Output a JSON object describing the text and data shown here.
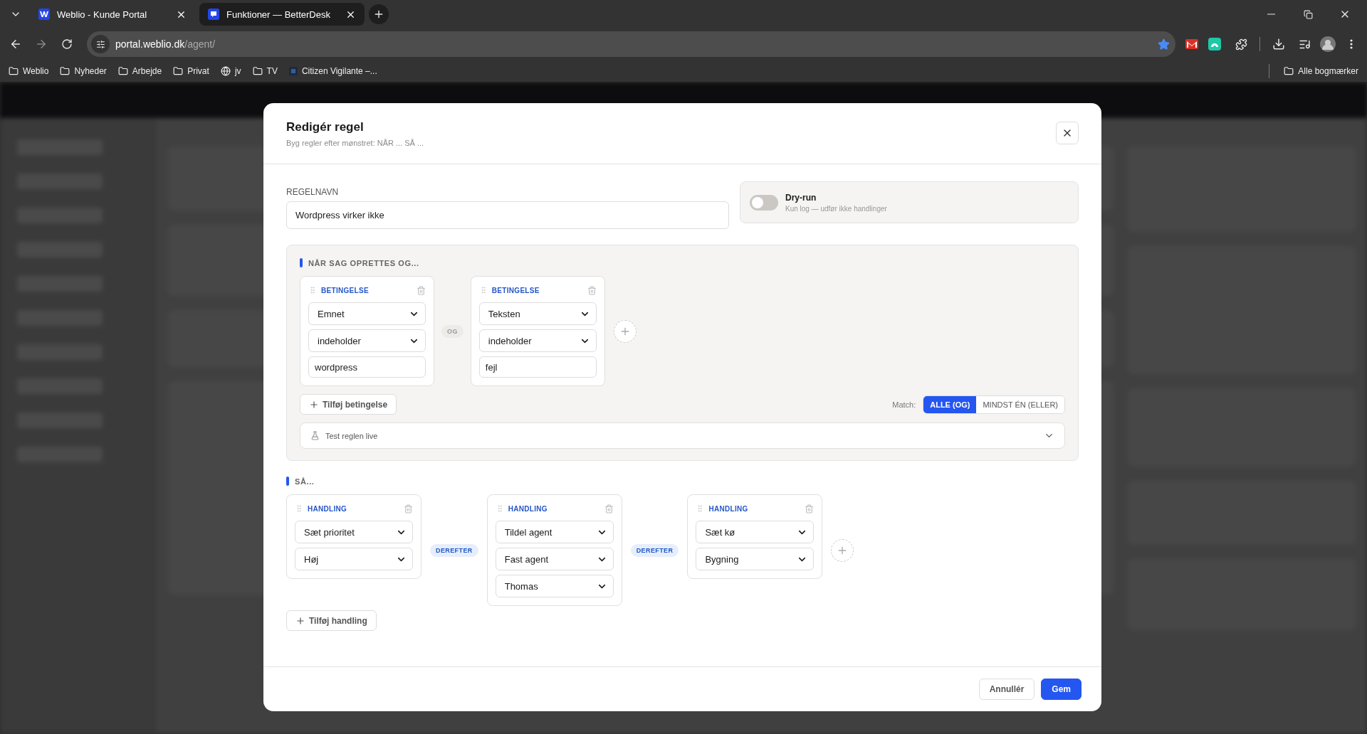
{
  "browser": {
    "tabs": [
      {
        "title": "Weblio - Kunde Portal",
        "selected": false,
        "kind": "w"
      },
      {
        "title": "Funktioner — BetterDesk",
        "selected": true,
        "kind": "chat"
      }
    ],
    "url": {
      "host": "portal.weblio.dk",
      "path": "/agent/"
    },
    "bookmarks": [
      {
        "label": "Weblio",
        "kind": "folder"
      },
      {
        "label": "Nyheder",
        "kind": "folder"
      },
      {
        "label": "Arbejde",
        "kind": "folder"
      },
      {
        "label": "Privat",
        "kind": "folder"
      },
      {
        "label": "jv",
        "kind": "globe"
      },
      {
        "label": "TV",
        "kind": "folder"
      },
      {
        "label": "Citizen Vigilante –...",
        "kind": "site"
      }
    ],
    "all_bookmarks": "Alle bogmærker"
  },
  "modal": {
    "title": "Redigér regel",
    "subtitle": "Byg regler efter mønstret: NÅR ... SÅ ...",
    "rule_name": {
      "label": "REGELNAVN",
      "value": "Wordpress virker ikke"
    },
    "dry_run": {
      "title": "Dry-run",
      "description": "Kun log — udfør ikke handlinger",
      "on": false
    },
    "conditions": {
      "heading": "NÅR SAG OPRETTES OG...",
      "joiners": [
        "OG"
      ],
      "items": [
        {
          "label": "BETINGELSE",
          "fields": [
            {
              "kind": "select",
              "value": "Emnet"
            },
            {
              "kind": "select",
              "value": "indeholder"
            },
            {
              "kind": "text",
              "value": "wordpress"
            }
          ]
        },
        {
          "label": "BETINGELSE",
          "fields": [
            {
              "kind": "select",
              "value": "Teksten"
            },
            {
              "kind": "select",
              "value": "indeholder"
            },
            {
              "kind": "text",
              "value": "fejl"
            }
          ]
        }
      ],
      "add_button": "Tilføj betingelse",
      "match": {
        "label": "Match:",
        "options": [
          {
            "label": "ALLE (OG)",
            "selected": true
          },
          {
            "label": "MINDST ÉN (ELLER)",
            "selected": false
          }
        ]
      },
      "test": {
        "label": "Test reglen live",
        "expanded": false
      }
    },
    "actions": {
      "heading": "SÅ...",
      "joiners": [
        "DEREFTER",
        "DEREFTER"
      ],
      "items": [
        {
          "label": "HANDLING",
          "fields": [
            {
              "kind": "select",
              "value": "Sæt prioritet"
            },
            {
              "kind": "select",
              "value": "Høj"
            }
          ]
        },
        {
          "label": "HANDLING",
          "fields": [
            {
              "kind": "select",
              "value": "Tildel agent"
            },
            {
              "kind": "select",
              "value": "Fast agent"
            },
            {
              "kind": "select",
              "value": "Thomas"
            }
          ]
        },
        {
          "label": "HANDLING",
          "fields": [
            {
              "kind": "select",
              "value": "Sæt kø"
            },
            {
              "kind": "select",
              "value": "Bygning"
            }
          ]
        }
      ],
      "add_button": "Tilføj handling"
    },
    "footer": [
      {
        "label": "Annullér",
        "kind": "secondary"
      },
      {
        "label": "Gem",
        "kind": "primary"
      }
    ]
  }
}
